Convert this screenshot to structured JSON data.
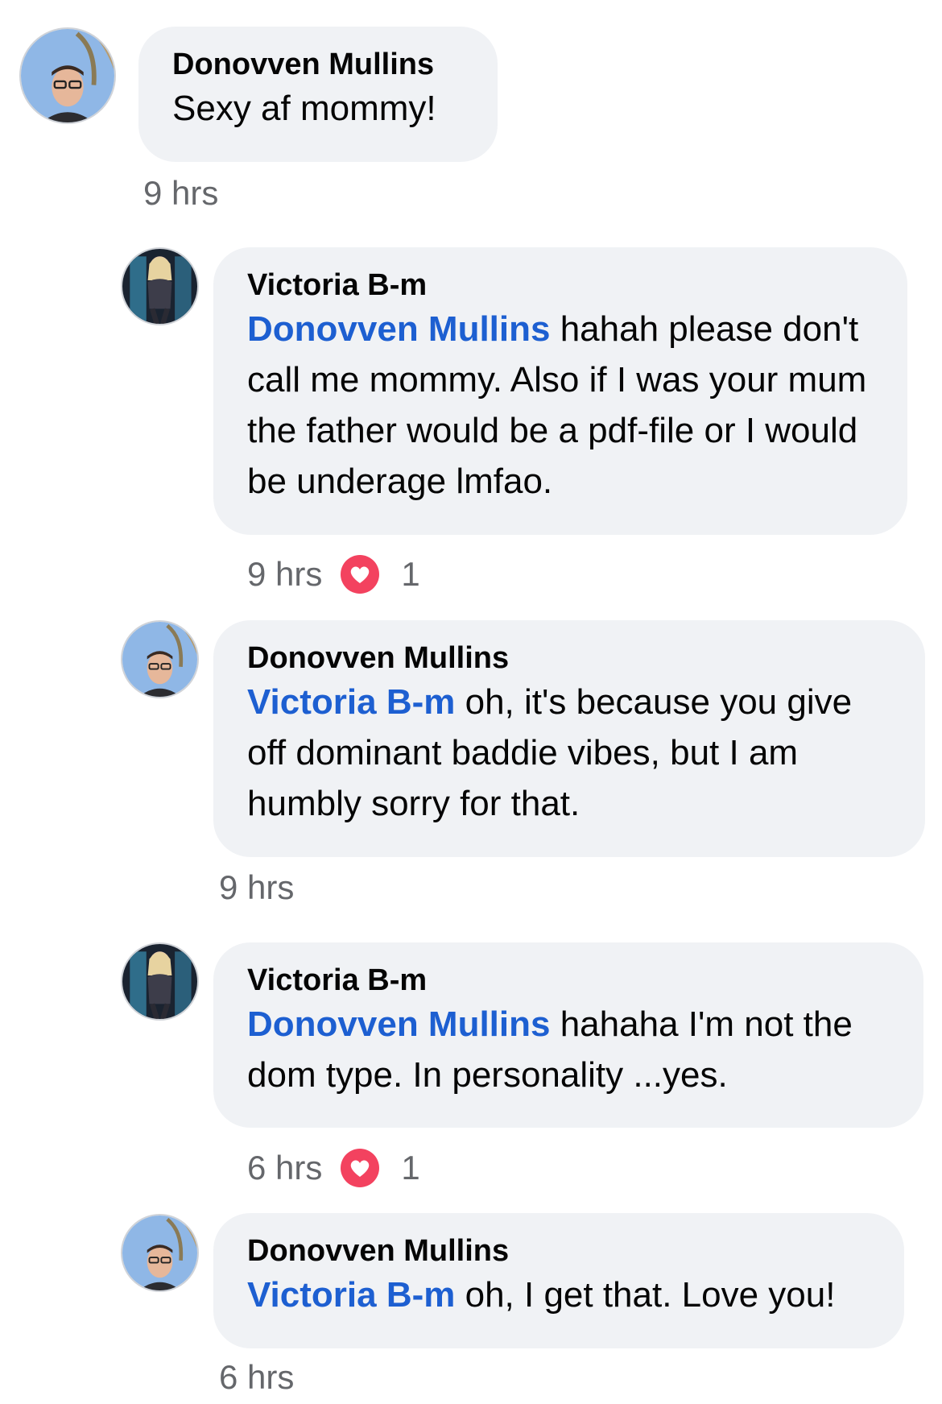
{
  "comments": [
    {
      "author": "Donovven Mullins",
      "mention": "",
      "text": "Sexy af mommy!",
      "time": "9 hrs",
      "reactions": ""
    },
    {
      "author": "Victoria B-m",
      "mention": "Donovven Mullins",
      "text": " hahah please don't call me mommy. Also if I was your mum the father would be a pdf-file or I would be underage lmfao.",
      "time": "9 hrs",
      "reactions": "1"
    },
    {
      "author": "Donovven Mullins",
      "mention": "Victoria B-m",
      "text": " oh, it's because you give off dominant baddie vibes, but I am humbly sorry for that.",
      "time": "9 hrs",
      "reactions": ""
    },
    {
      "author": "Victoria B-m",
      "mention": "Donovven Mullins",
      "text": " hahaha I'm not the dom type. In personality ...yes.",
      "time": "6 hrs",
      "reactions": "1"
    },
    {
      "author": "Donovven Mullins",
      "mention": "Victoria B-m",
      "text": " oh, I get that. Love you!",
      "time": "6 hrs",
      "reactions": ""
    }
  ],
  "icons": {
    "avatar_donovven": "man-with-glasses-avatar",
    "avatar_victoria": "woman-in-costume-avatar",
    "reaction": "heart-reaction-icon"
  },
  "colors": {
    "bubble": "#f0f2f5",
    "mention": "#1d5fd1",
    "meta": "#65676b",
    "heart": "#f3425f"
  }
}
